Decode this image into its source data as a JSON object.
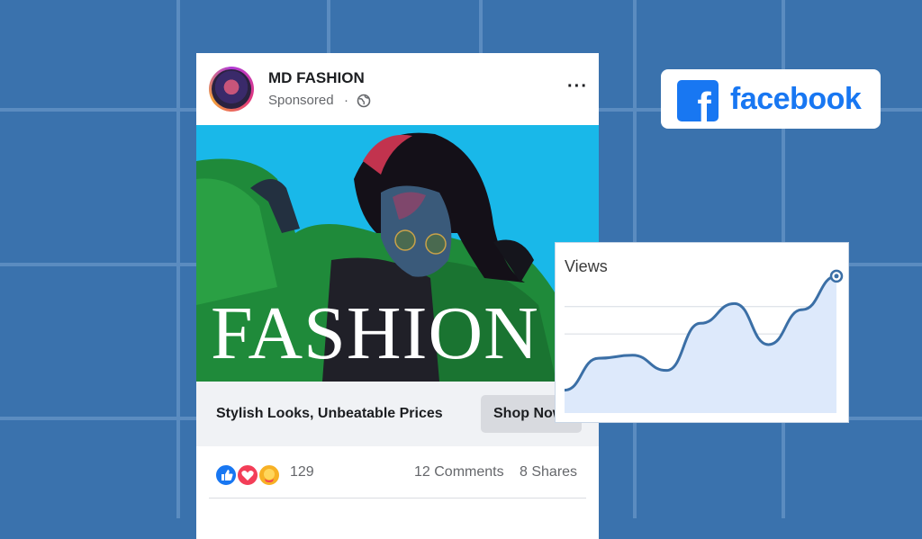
{
  "post": {
    "page_name": "MD FASHION",
    "sponsored": "Sponsored",
    "separator": "·",
    "more": "···",
    "hero_title": "FASHION",
    "tagline": "Stylish Looks, Unbeatable Prices",
    "cta": "Shop Now",
    "reaction_count": "129",
    "comments": "12 Comments",
    "shares": "8 Shares"
  },
  "brand": {
    "logo_letter": "f",
    "wordmark": "facebook",
    "color": "#1877f2"
  },
  "chart_data": {
    "type": "area",
    "title": "Views",
    "x": [
      0,
      1,
      2,
      3,
      4,
      5,
      6,
      7,
      8
    ],
    "values": [
      1.5,
      3.6,
      3.8,
      2.8,
      5.9,
      7.2,
      4.5,
      6.8,
      9.0
    ],
    "ylim": [
      0,
      10
    ],
    "grid": true,
    "line_color": "#3b6fa6",
    "fill_color": "#dde9fb"
  },
  "icons": {
    "globe": "globe-icon",
    "like": "like-icon",
    "love": "love-icon",
    "care": "care-icon"
  }
}
